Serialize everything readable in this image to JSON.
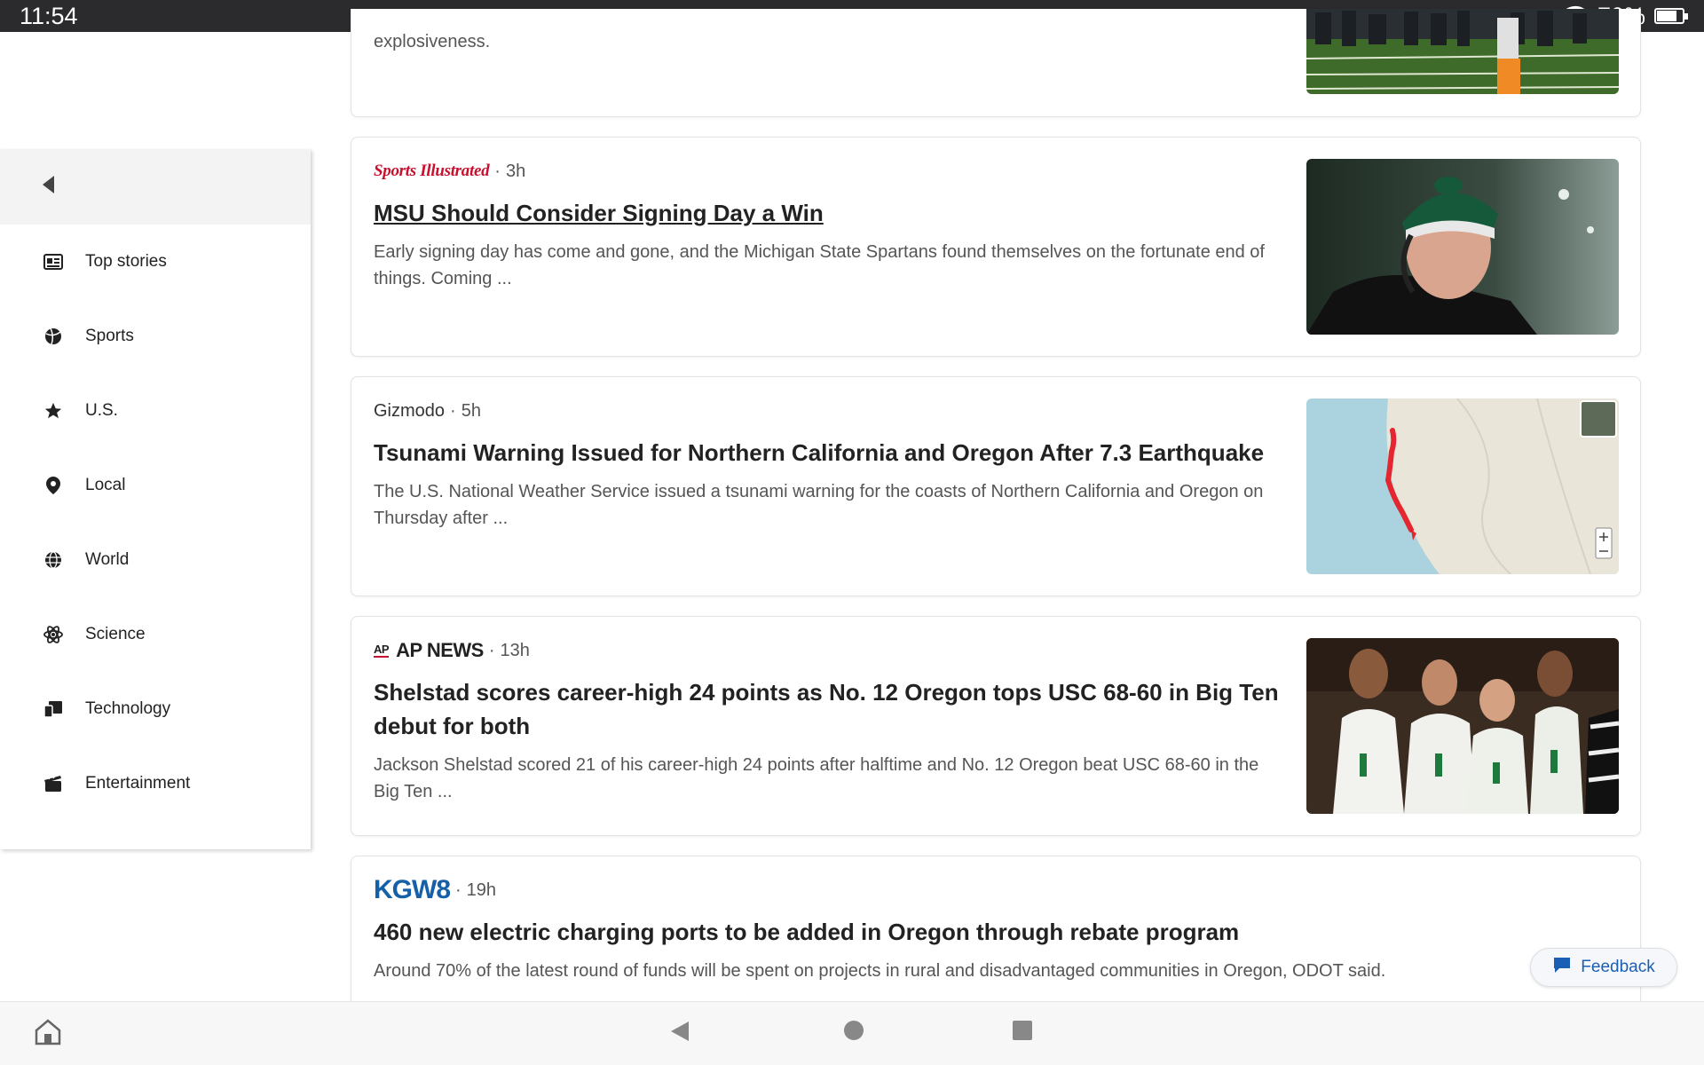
{
  "status_bar": {
    "time": "11:54",
    "battery": "70%"
  },
  "sidebar": {
    "collapse_icon": "chevron-left-icon",
    "items": [
      {
        "label": "Top stories",
        "icon": "newspaper-icon"
      },
      {
        "label": "Sports",
        "icon": "ball-icon"
      },
      {
        "label": "U.S.",
        "icon": "star-icon"
      },
      {
        "label": "Local",
        "icon": "location-pin-icon"
      },
      {
        "label": "World",
        "icon": "globe-icon"
      },
      {
        "label": "Science",
        "icon": "atom-icon"
      },
      {
        "label": "Technology",
        "icon": "devices-icon"
      },
      {
        "label": "Entertainment",
        "icon": "clapperboard-icon"
      }
    ]
  },
  "feed": {
    "partial_card": {
      "snippet_tail": "explosiveness."
    },
    "articles": [
      {
        "source": "Sports Illustrated",
        "time": "3h",
        "headline": "MSU Should Consider Signing Day a Win",
        "snippet": "Early signing day has come and gone, and the Michigan State Spartans found themselves on the fortunate end of things.  Coming ..."
      },
      {
        "source": "Gizmodo",
        "time": "5h",
        "headline": "Tsunami Warning Issued for Northern California and Oregon After 7.3 Earthquake",
        "snippet": "The U.S. National Weather Service issued a tsunami warning for the coasts of Northern California and Oregon on Thursday after ..."
      },
      {
        "source": "AP NEWS",
        "source_mark": "AP",
        "time": "13h",
        "headline": "Shelstad scores career-high 24 points as No. 12 Oregon tops USC 68-60 in Big Ten debut for both",
        "snippet": "Jackson Shelstad scored 21 of his career-high 24 points after halftime and No. 12 Oregon beat USC 68-60 in the Big Ten ..."
      },
      {
        "source": "KGW8",
        "time": "19h",
        "headline": "460 new electric charging ports to be added in Oregon through rebate program",
        "snippet": "Around 70% of the latest round of funds will be spent on projects in rural and disadvantaged communities in Oregon, ODOT said."
      }
    ]
  },
  "feedback": {
    "label": "Feedback",
    "icon": "chat-bubble-icon"
  },
  "nav_bar": {
    "home_icon": "home-icon",
    "back_icon": "back-triangle-icon",
    "home_button_icon": "circle-home-icon",
    "recents_icon": "square-recents-icon"
  },
  "colors": {
    "status_bar_bg": "#2b2b2d",
    "sports_illustrated_red": "#c8102e",
    "kgw_blue": "#1560a8",
    "feedback_blue": "#1a5fb4"
  }
}
